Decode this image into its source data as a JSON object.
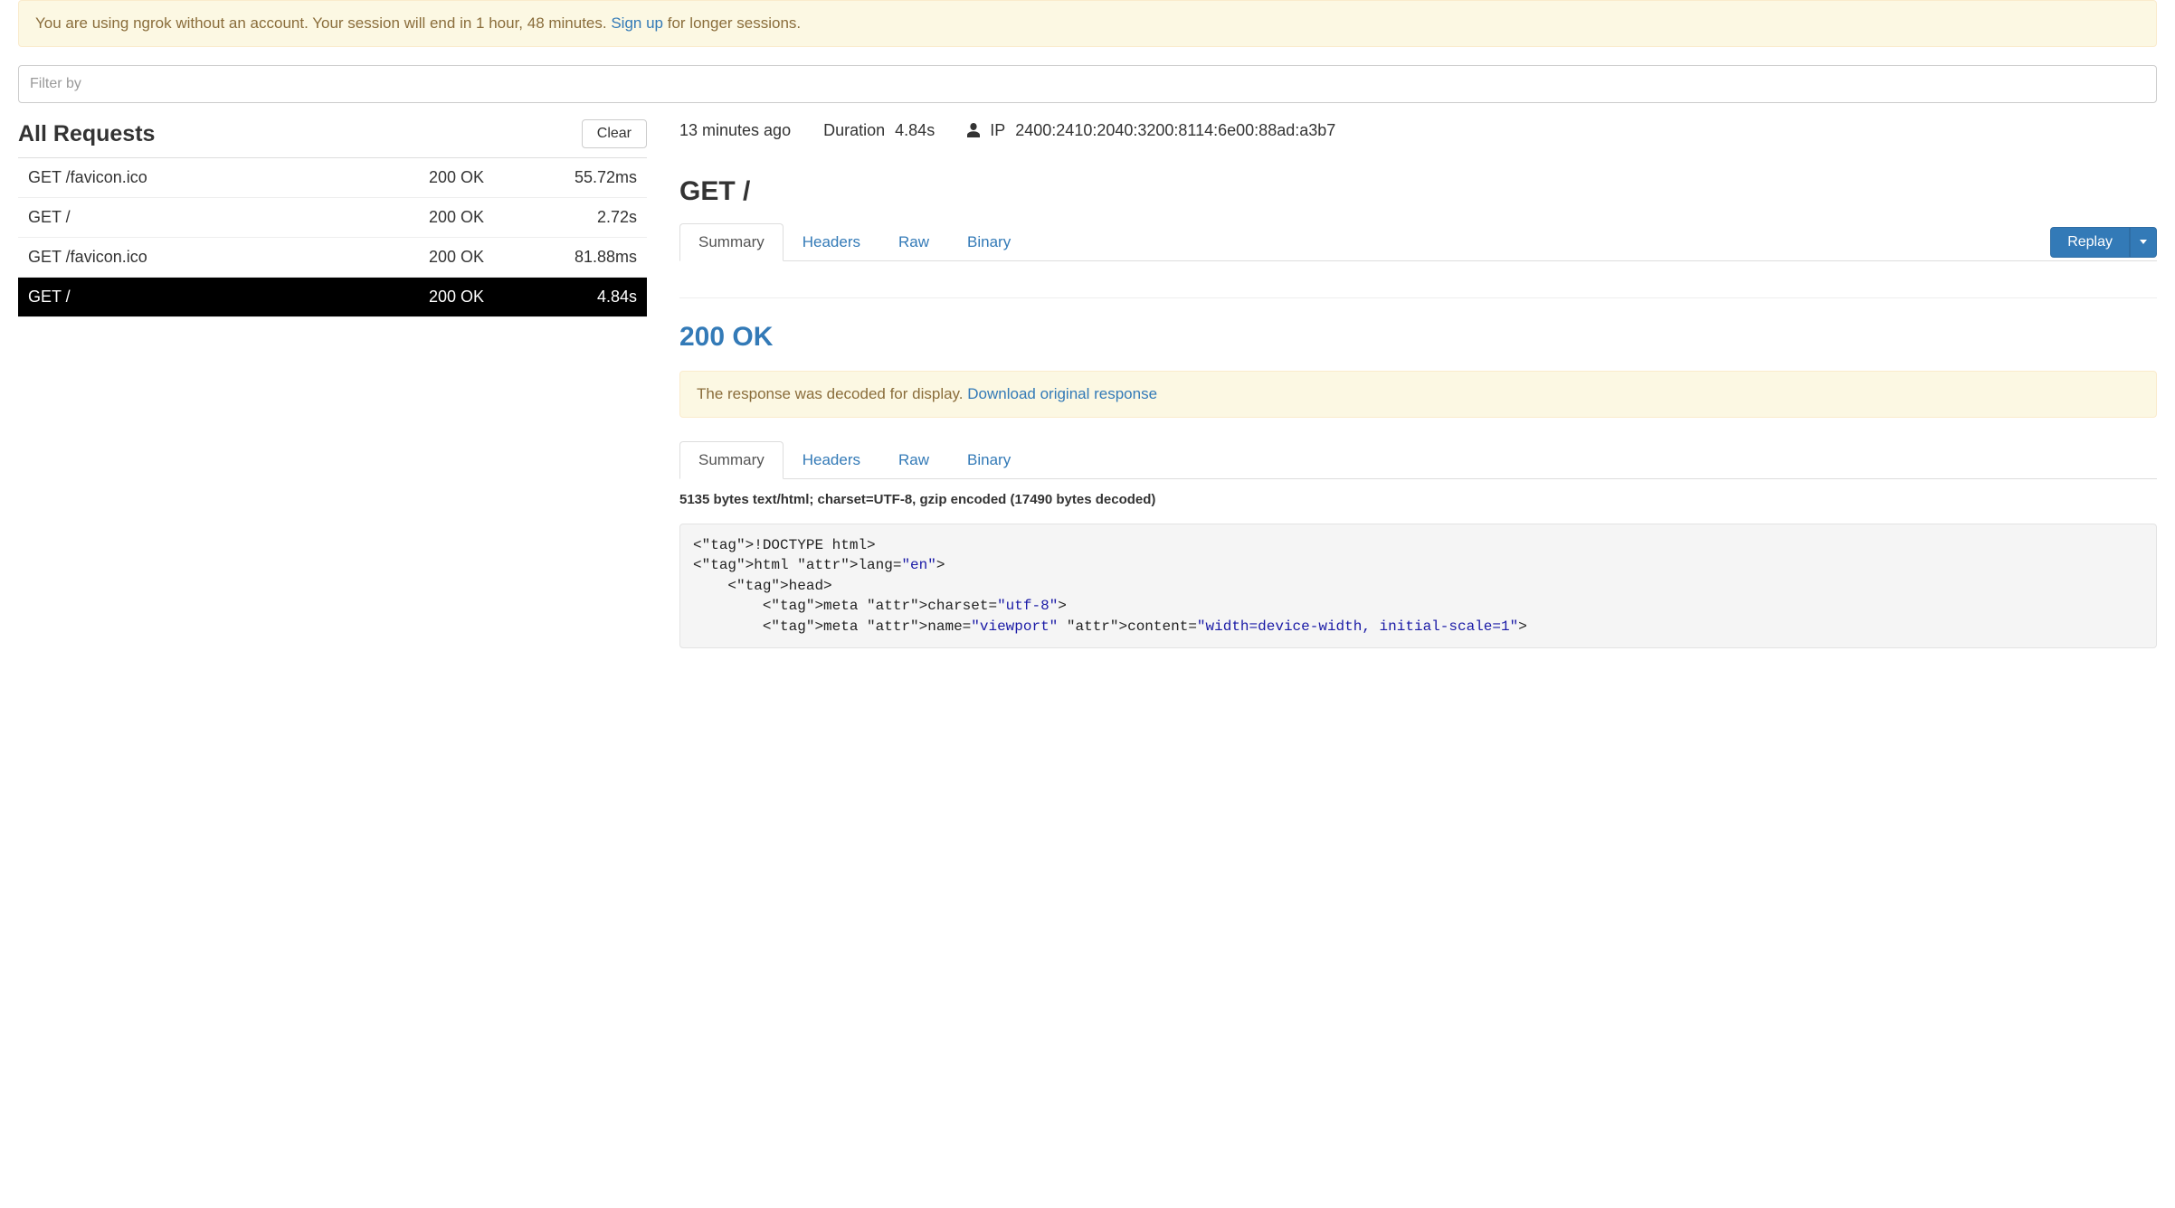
{
  "banner": {
    "text_before": "You are using ngrok without an account. Your session will end in 1 hour, 48 minutes. ",
    "link_label": "Sign up",
    "text_after": " for longer sessions."
  },
  "filter": {
    "placeholder": "Filter by"
  },
  "requests_header": {
    "title": "All Requests",
    "clear_label": "Clear"
  },
  "requests": [
    {
      "method_path": "GET /favicon.ico",
      "status": "200 OK",
      "duration": "55.72ms",
      "selected": false
    },
    {
      "method_path": "GET /",
      "status": "200 OK",
      "duration": "2.72s",
      "selected": false
    },
    {
      "method_path": "GET /favicon.ico",
      "status": "200 OK",
      "duration": "81.88ms",
      "selected": false
    },
    {
      "method_path": "GET /",
      "status": "200 OK",
      "duration": "4.84s",
      "selected": true
    }
  ],
  "detail": {
    "age": "13 minutes ago",
    "duration_label": "Duration",
    "duration_value": "4.84s",
    "ip_label": "IP",
    "ip_value": "2400:2410:2040:3200:8114:6e00:88ad:a3b7",
    "request_title": "GET /",
    "tabs": [
      "Summary",
      "Headers",
      "Raw",
      "Binary"
    ],
    "active_tab": "Summary",
    "replay_label": "Replay",
    "status_title": "200 OK",
    "decode_notice_before": "The response was decoded for display. ",
    "decode_notice_link": "Download original response",
    "response_tabs": [
      "Summary",
      "Headers",
      "Raw",
      "Binary"
    ],
    "response_active_tab": "Summary",
    "encoding_meta": "5135 bytes text/html; charset=UTF-8, gzip encoded (17490 bytes decoded)",
    "body_lines": [
      "<!DOCTYPE html>",
      "<html lang=\"en\">",
      "    <head>",
      "        <meta charset=\"utf-8\">",
      "        <meta name=\"viewport\" content=\"width=device-width, initial-scale=1\">"
    ]
  }
}
